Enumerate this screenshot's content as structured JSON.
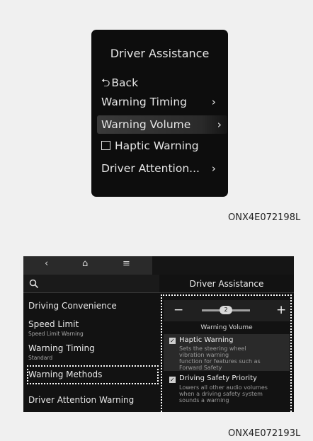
{
  "cluster": {
    "title": "Driver Assistance",
    "items": [
      {
        "label": "Back"
      },
      {
        "label": "Warning Timing"
      },
      {
        "label": "Warning Volume"
      },
      {
        "label": "Haptic Warning"
      },
      {
        "label": "Driver Attention..."
      }
    ],
    "selected_item": "Warning Volume",
    "code": "ONX4E072198L"
  },
  "screen": {
    "header_title": "Driver Assistance",
    "menu": [
      {
        "title": "Driving Convenience",
        "subtitle": ""
      },
      {
        "title": "Speed Limit",
        "subtitle": "Speed Limit Warning"
      },
      {
        "title": "Warning Timing",
        "subtitle": "Standard"
      },
      {
        "title": "Warning Methods",
        "subtitle": ""
      },
      {
        "title": "Driver Attention Warning",
        "subtitle": ""
      }
    ],
    "highlighted_menu": "Warning Methods",
    "volume": {
      "minus": "−",
      "plus": "+",
      "value": "2",
      "label": "Warning Volume"
    },
    "options": [
      {
        "title": "Haptic Warning",
        "desc_lines": [
          "Sets the steering wheel",
          "vibration warning",
          "function for features such as",
          "Forward Safety"
        ],
        "checked": true
      },
      {
        "title": "Driving Safety Priority",
        "desc_lines": [
          "Lowers all other audio volumes",
          "when a driving safety system",
          "sounds a warning"
        ],
        "checked": true
      }
    ],
    "icons": [
      "back-chevron-icon",
      "home-icon",
      "menu-icon",
      "search-icon"
    ],
    "code": "ONX4E072193L"
  }
}
